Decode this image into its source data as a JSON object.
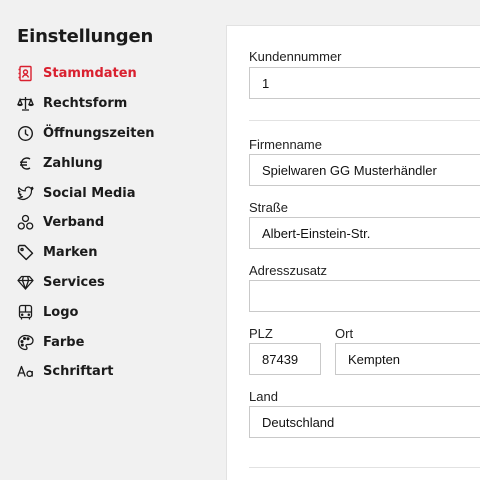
{
  "sidebar": {
    "title": "Einstellungen",
    "items": [
      {
        "label": "Stammdaten",
        "icon": "address-book-icon",
        "active": true
      },
      {
        "label": "Rechtsform",
        "icon": "scale-icon",
        "active": false
      },
      {
        "label": "Öffnungszeiten",
        "icon": "clock-icon",
        "active": false
      },
      {
        "label": "Zahlung",
        "icon": "euro-icon",
        "active": false
      },
      {
        "label": "Social Media",
        "icon": "twitter-bird-icon",
        "active": false
      },
      {
        "label": "Verband",
        "icon": "group-circles-icon",
        "active": false
      },
      {
        "label": "Marken",
        "icon": "tag-icon",
        "active": false
      },
      {
        "label": "Services",
        "icon": "diamond-icon",
        "active": false
      },
      {
        "label": "Logo",
        "icon": "bus-icon",
        "active": false
      },
      {
        "label": "Farbe",
        "icon": "palette-icon",
        "active": false
      },
      {
        "label": "Schriftart",
        "icon": "font-aa-icon",
        "active": false
      }
    ]
  },
  "form": {
    "kundennummer": {
      "label": "Kundennummer",
      "value": "1"
    },
    "firmenname": {
      "label": "Firmenname",
      "value": "Spielwaren GG Musterhändler"
    },
    "strasse": {
      "label": "Straße",
      "value": "Albert-Einstein-Str."
    },
    "adresszusatz": {
      "label": "Adresszusatz",
      "value": ""
    },
    "plz": {
      "label": "PLZ",
      "value": "87439"
    },
    "ort": {
      "label": "Ort",
      "value": "Kempten"
    },
    "land": {
      "label": "Land",
      "value": "Deutschland"
    }
  },
  "colors": {
    "accent": "#d9202f",
    "text": "#1b1b1b",
    "background": "#f1f1f1"
  }
}
